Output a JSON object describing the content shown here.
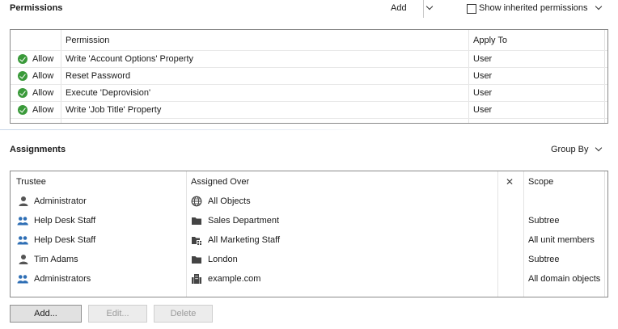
{
  "permissions": {
    "title": "Permissions",
    "add_label": "Add",
    "show_inherited_label": "Show inherited permissions",
    "show_inherited_checked": false,
    "columns": [
      "",
      "Permission",
      "Apply To"
    ],
    "rows": [
      {
        "status": "Allow",
        "permission": "Write 'Account Options' Property",
        "apply_to": "User"
      },
      {
        "status": "Allow",
        "permission": "Reset Password",
        "apply_to": "User"
      },
      {
        "status": "Allow",
        "permission": "Execute 'Deprovision'",
        "apply_to": "User"
      },
      {
        "status": "Allow",
        "permission": "Write 'Job Title' Property",
        "apply_to": "User"
      }
    ]
  },
  "assignments": {
    "title": "Assignments",
    "group_by_label": "Group By",
    "columns": {
      "trustee": "Trustee",
      "assigned_over": "Assigned Over",
      "clear": "✕",
      "scope": "Scope"
    },
    "rows": [
      {
        "trustee": "Administrator",
        "trustee_icon": "user-icon",
        "assigned_over": "All Objects",
        "over_icon": "globe-icon",
        "scope": ""
      },
      {
        "trustee": "Help Desk Staff",
        "trustee_icon": "group-icon",
        "assigned_over": "Sales Department",
        "over_icon": "folder-icon",
        "scope": "Subtree"
      },
      {
        "trustee": "Help Desk Staff",
        "trustee_icon": "group-icon",
        "assigned_over": "All Marketing Staff",
        "over_icon": "business-unit-icon",
        "scope": "All unit members"
      },
      {
        "trustee": "Tim Adams",
        "trustee_icon": "user-icon",
        "assigned_over": "London",
        "over_icon": "folder-icon",
        "scope": "Subtree"
      },
      {
        "trustee": "Administrators",
        "trustee_icon": "group-icon",
        "assigned_over": "example.com",
        "over_icon": "domain-icon",
        "scope": "All domain objects"
      }
    ]
  },
  "buttons": {
    "add": "Add...",
    "edit": "Edit...",
    "delete": "Delete"
  },
  "colors": {
    "allow_green": "#3a9a3a",
    "group_blue": "#2f6fb5",
    "user_gray": "#555555"
  }
}
